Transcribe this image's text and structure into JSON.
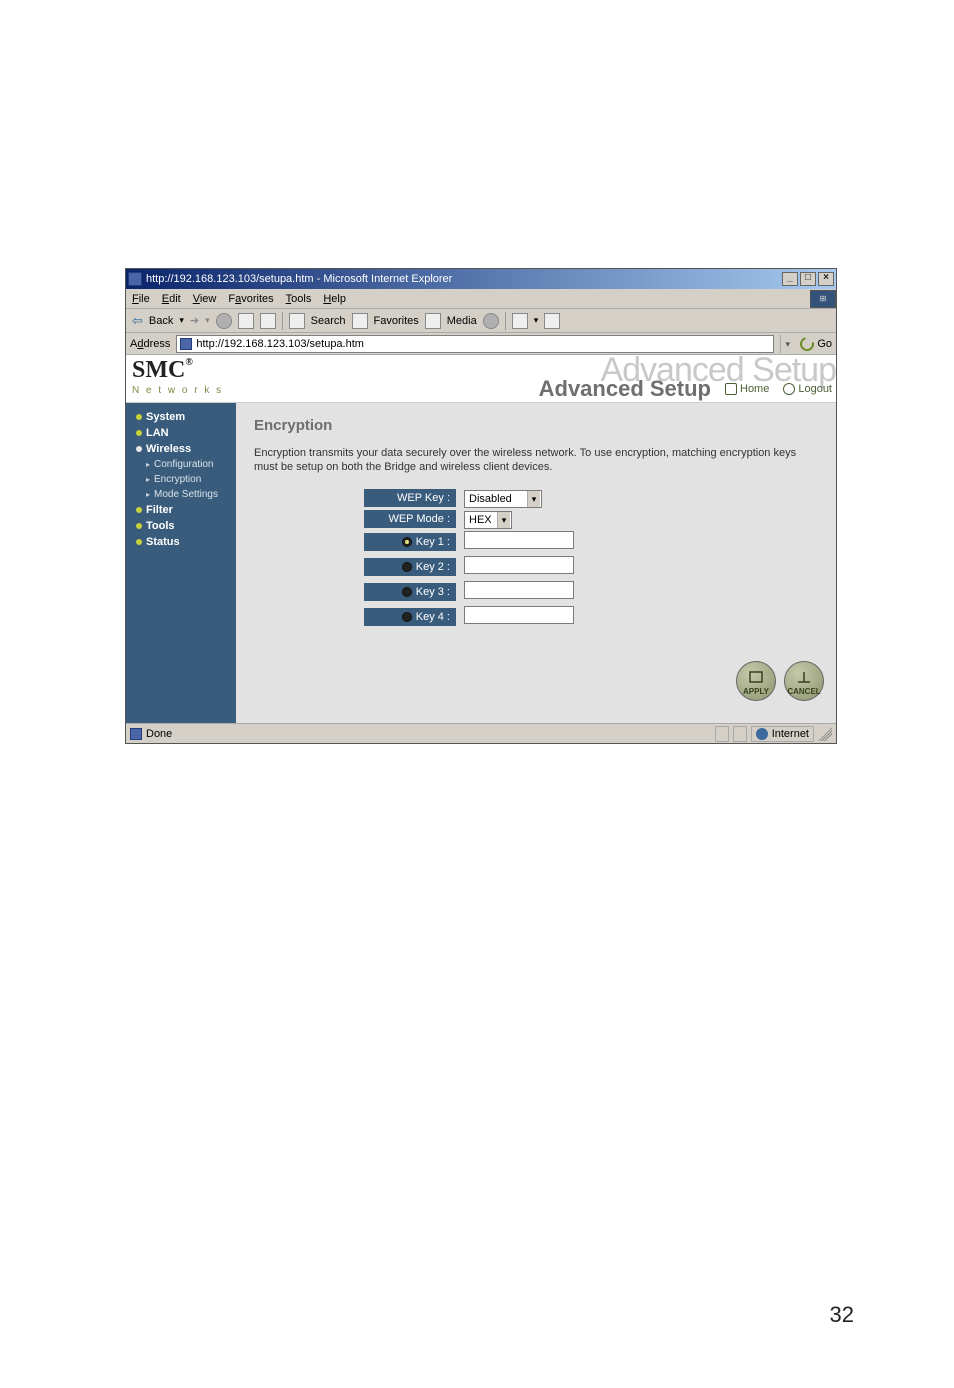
{
  "page_number": "32",
  "browser": {
    "title": "http://192.168.123.103/setupa.htm - Microsoft Internet Explorer",
    "win_min": "_",
    "win_max": "□",
    "win_close": "×",
    "menu": {
      "file": "File",
      "edit": "Edit",
      "view": "View",
      "favorites": "Favorites",
      "tools": "Tools",
      "help": "Help"
    },
    "toolbar": {
      "back_label": "Back",
      "search_label": "Search",
      "favorites_label": "Favorites",
      "media_label": "Media"
    },
    "address_label": "Address",
    "address_url": "http://192.168.123.103/setupa.htm",
    "go_label": "Go",
    "status_done": "Done",
    "status_zone": "Internet"
  },
  "brand": {
    "logo_text": "SMC",
    "logo_reg": "®",
    "logo_sub": "N e t w o r k s",
    "ghost_text": "Advanced Setup",
    "adv_setup": "Advanced Setup",
    "home_link": "Home",
    "logout_link": "Logout"
  },
  "sidebar": {
    "system": "System",
    "lan": "LAN",
    "wireless": "Wireless",
    "configuration": "Configuration",
    "encryption": "Encryption",
    "mode_settings": "Mode Settings",
    "filter": "Filter",
    "tools": "Tools",
    "status": "Status"
  },
  "panel": {
    "title": "Encryption",
    "desc": "Encryption transmits your data securely over the wireless network. To use encryption, matching encryption keys must be setup on both the Bridge and wireless client devices.",
    "labels": {
      "wep_key": "WEP Key :",
      "wep_mode": "WEP Mode :",
      "key1": "Key 1 :",
      "key2": "Key 2 :",
      "key3": "Key 3 :",
      "key4": "Key 4 :"
    },
    "values": {
      "wep_key_selected": "Disabled",
      "wep_mode_selected": "HEX"
    },
    "buttons": {
      "apply": "APPLY",
      "cancel": "CANCEL"
    }
  }
}
